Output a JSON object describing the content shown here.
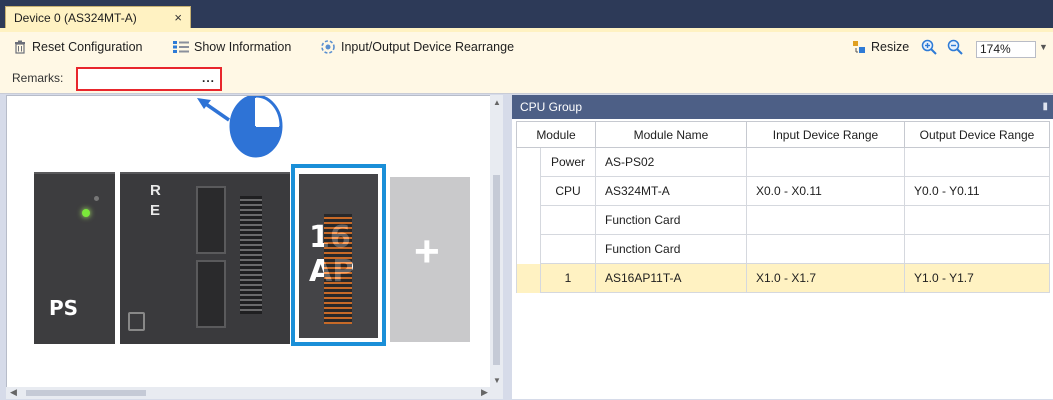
{
  "document_tab": {
    "title": "Device 0 (AS324MT-A)",
    "close": "×"
  },
  "toolbar": {
    "reset": "Reset Configuration",
    "show_info": "Show Information",
    "rearrange": "Input/Output Device Rearrange",
    "resize": "Resize",
    "zoom": "174%"
  },
  "remarks": {
    "label": "Remarks:",
    "value": "",
    "browse": "..."
  },
  "hardware": {
    "ps_label": "PS",
    "cpu_leds": [
      "R",
      "E"
    ],
    "module_label_line1": "16",
    "module_label_line2": "AP",
    "add_symbol": "+"
  },
  "cpu_group": {
    "title": "CPU Group",
    "columns": [
      "Module",
      "Module Name",
      "Input Device Range",
      "Output Device Range"
    ],
    "rows": [
      {
        "module": "Power",
        "name": "AS-PS02",
        "input": "",
        "output": ""
      },
      {
        "module": "CPU",
        "name": "AS324MT-A",
        "input": "X0.0 - X0.11",
        "output": "Y0.0 - Y0.11"
      },
      {
        "module": "",
        "name": "Function Card",
        "input": "",
        "output": ""
      },
      {
        "module": "",
        "name": "Function Card",
        "input": "",
        "output": ""
      },
      {
        "module": "1",
        "name": "AS16AP11T-A",
        "input": "X1.0 - X1.7",
        "output": "Y1.0 - Y1.7"
      }
    ]
  },
  "colors": {
    "accent_tab": "#fff2c2",
    "panel_header": "#4d5f86",
    "highlight_border": "#e8262c",
    "selected_module": "#1a8fd8"
  }
}
